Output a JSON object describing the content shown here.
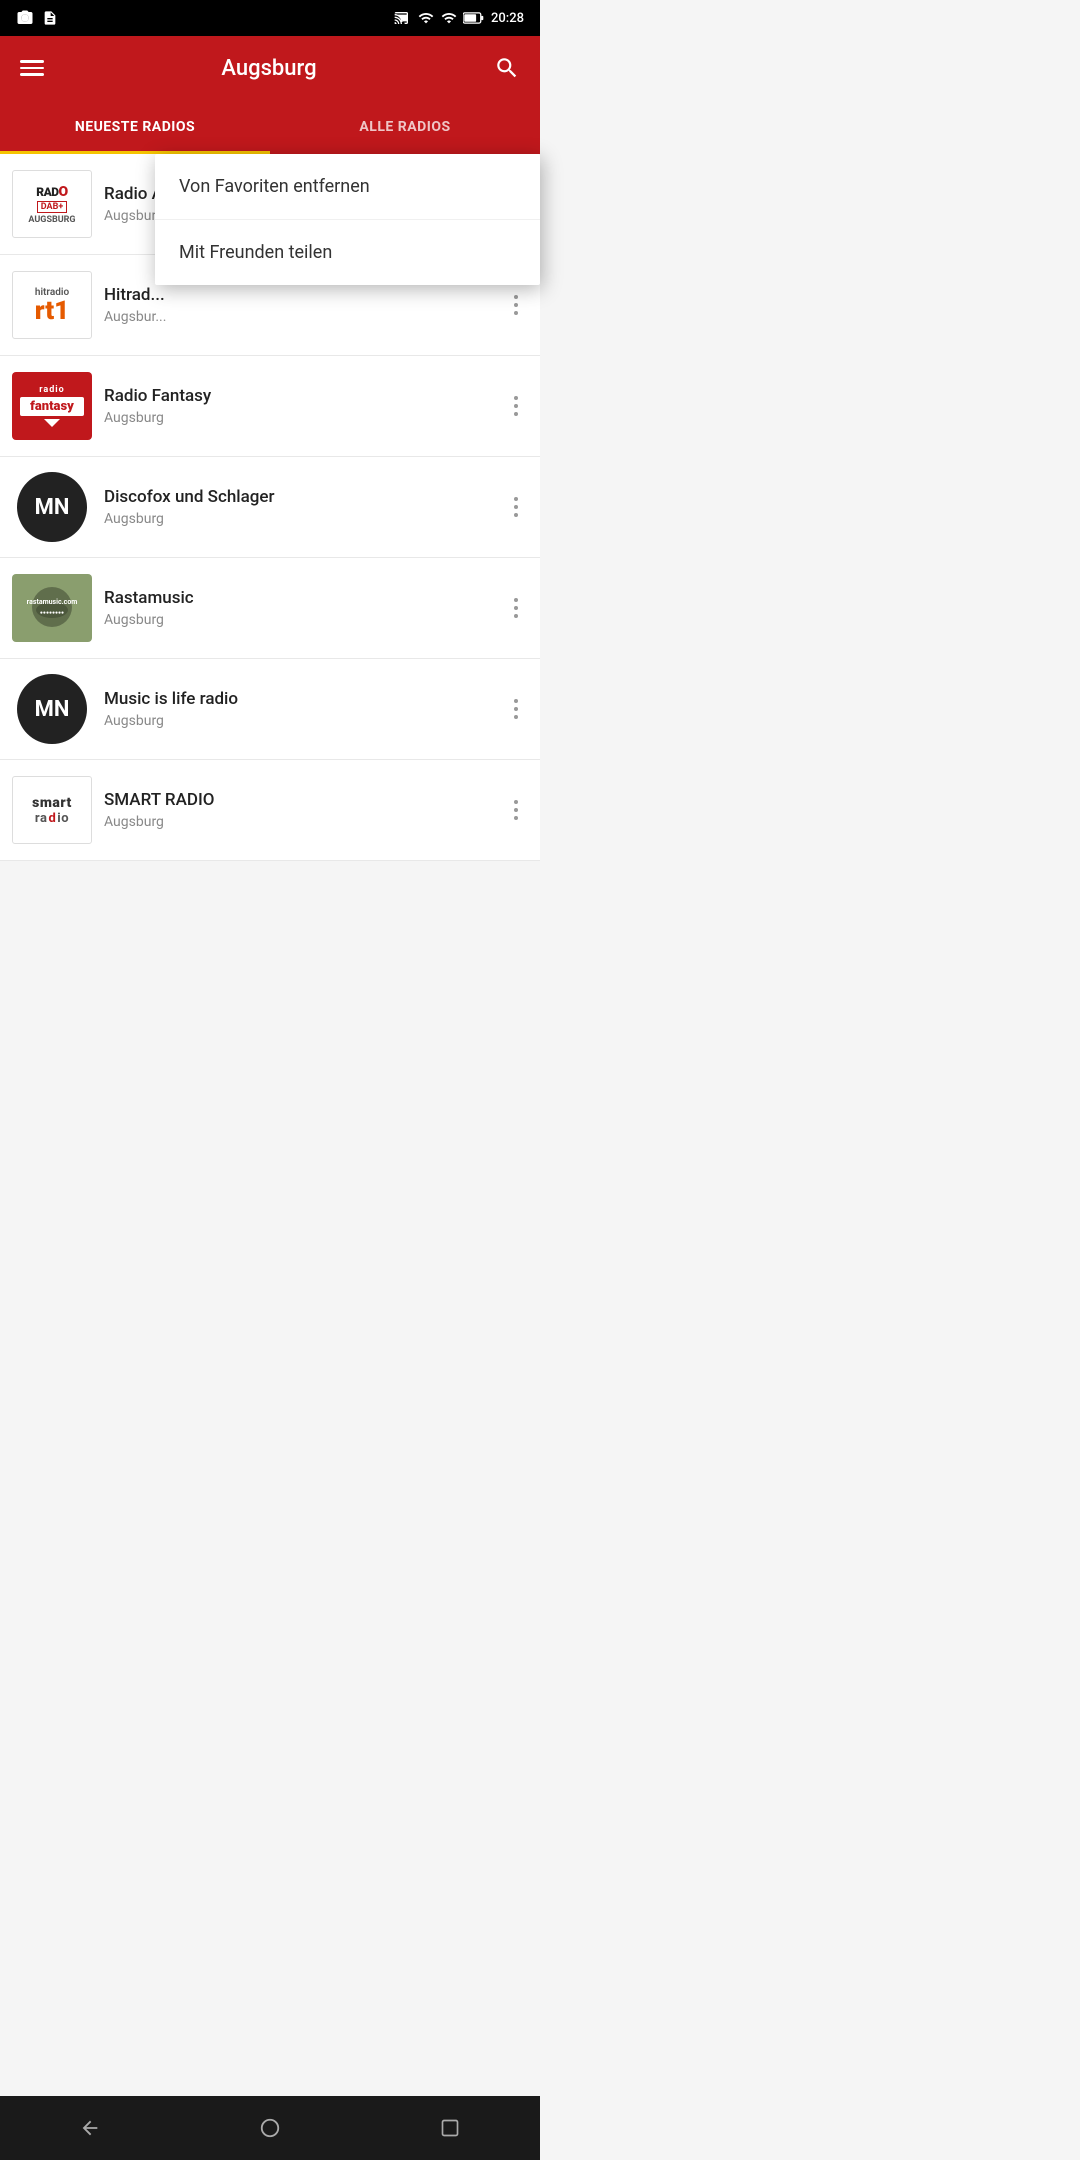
{
  "statusBar": {
    "time": "20:28",
    "icons": [
      "camera",
      "file"
    ]
  },
  "appBar": {
    "title": "Augsburg",
    "menuLabel": "menu",
    "searchLabel": "search"
  },
  "tabs": [
    {
      "id": "neueste",
      "label": "NEUESTE RADIOS",
      "active": true
    },
    {
      "id": "alle",
      "label": "ALLE RADIOS",
      "active": false
    }
  ],
  "contextMenu": {
    "visible": true,
    "items": [
      {
        "id": "remove-favorite",
        "label": "Von Favoriten entfernen"
      },
      {
        "id": "share",
        "label": "Mit Freunden teilen"
      }
    ]
  },
  "radioList": [
    {
      "id": "radio-augsburg",
      "name": "Radio Augsburg",
      "location": "Augsburg",
      "logoType": "radio-augsburg"
    },
    {
      "id": "hitradio-rt1",
      "name": "Hitrad...",
      "location": "Augsbur...",
      "logoType": "hitradio"
    },
    {
      "id": "radio-fantasy",
      "name": "Radio Fantasy",
      "location": "Augsburg",
      "logoType": "fantasy"
    },
    {
      "id": "discofox",
      "name": "Discofox und Schlager",
      "location": "Augsburg",
      "logoType": "mn"
    },
    {
      "id": "rastamusic",
      "name": "Rastamusic",
      "location": "Augsburg",
      "logoType": "rastamusic"
    },
    {
      "id": "music-is-life",
      "name": "Music is life radio",
      "location": "Augsburg",
      "logoType": "mn"
    },
    {
      "id": "smart-radio",
      "name": "SMART RADIO",
      "location": "Augsburg",
      "logoType": "smart"
    }
  ],
  "bottomNav": {
    "back": "◁",
    "home": "●",
    "recents": "□"
  }
}
